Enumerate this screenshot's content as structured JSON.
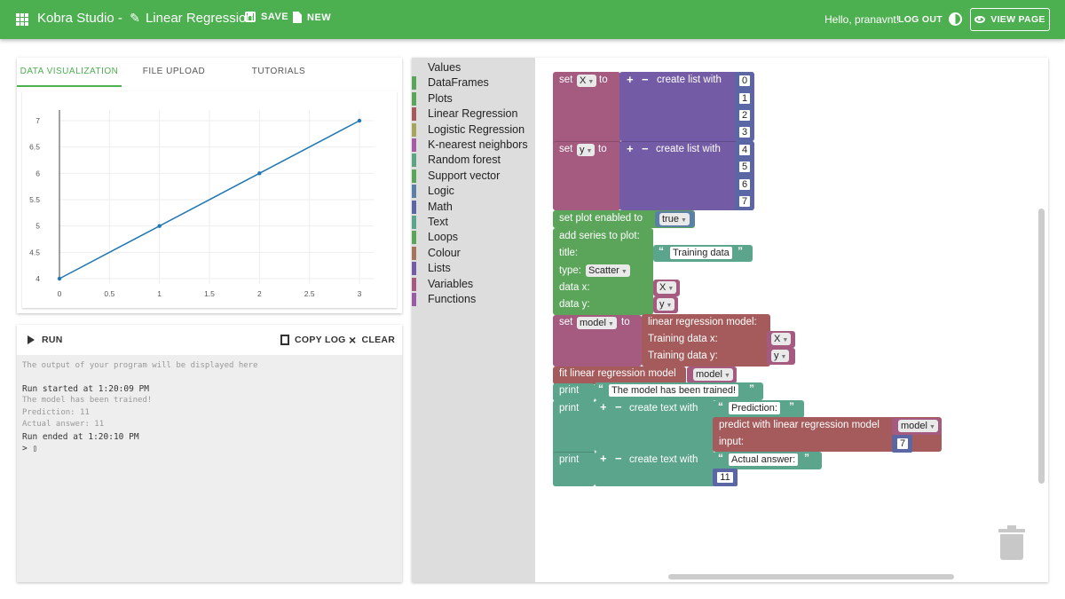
{
  "appbar": {
    "title": "Kobra Studio -",
    "project_name": "Linear Regression",
    "save_label": "SAVE",
    "new_label": "NEW",
    "greeting": "Hello, pranavnt!",
    "logout_label": "LOG OUT",
    "view_page_label": "VIEW PAGE",
    "bg_color": "#4caf50"
  },
  "viz": {
    "tabs": [
      "DATA VISUALIZATION",
      "FILE UPLOAD",
      "TUTORIALS"
    ],
    "active_tab": "DATA VISUALIZATION"
  },
  "chart_data": {
    "type": "line",
    "x": [
      0,
      1,
      2,
      3
    ],
    "y": [
      4,
      5,
      6,
      7
    ],
    "xlim": [
      0,
      3
    ],
    "ylim": [
      4,
      7
    ],
    "x_ticks": [
      "0",
      "0.5",
      "1",
      "1.5",
      "2",
      "2.5",
      "3"
    ],
    "y_ticks": [
      "4",
      "4.5",
      "5",
      "5.5",
      "6",
      "6.5",
      "7"
    ],
    "grid": true,
    "color": "#1f77b4",
    "markers": true
  },
  "console": {
    "run_label": "RUN",
    "copy_label": "COPY LOG",
    "clear_label": "CLEAR",
    "placeholder": "The output of your program will be displayed here",
    "run_started": "Run started at 1:20:09 PM",
    "line_trained": "The model has been trained!",
    "line_prediction": "Prediction: 11",
    "line_actual": "Actual answer: 11",
    "run_ended": "Run ended at 1:20:10 PM",
    "prompt": "> ▯"
  },
  "toolbox": {
    "categories": [
      {
        "label": "Values",
        "color": ""
      },
      {
        "label": "DataFrames",
        "color": "#5ba55b"
      },
      {
        "label": "Plots",
        "color": "#5ba55b"
      },
      {
        "label": "Linear Regression",
        "color": "#a55b5b"
      },
      {
        "label": "Logistic Regression",
        "color": "#a5a55b"
      },
      {
        "label": "K-nearest neighbors",
        "color": "#a55ba5"
      },
      {
        "label": "Random forest",
        "color": "#5ba580"
      },
      {
        "label": "Support vector",
        "color": "#5ba55b"
      },
      {
        "label": "Logic",
        "color": "#5b80a5"
      },
      {
        "label": "Math",
        "color": "#5b67a5"
      },
      {
        "label": "Text",
        "color": "#5ba58c"
      },
      {
        "label": "Loops",
        "color": "#5ba55b"
      },
      {
        "label": "Colour",
        "color": "#a5745b"
      },
      {
        "label": "Lists",
        "color": "#745ba5"
      },
      {
        "label": "Variables",
        "color": "#a55b80"
      },
      {
        "label": "Functions",
        "color": "#995ba5"
      }
    ]
  },
  "blocks": {
    "set_label": "set",
    "to_label": "to",
    "plus": "+",
    "minus": "−",
    "create_list_with": "create list with",
    "var_x": "X",
    "var_y": "y",
    "x_values": [
      "0",
      "1",
      "2",
      "3"
    ],
    "y_values": [
      "4",
      "5",
      "6",
      "7"
    ],
    "set_plot_enabled": "set plot enabled to",
    "bool_true": "true",
    "add_series": "add series to plot:",
    "title_label": "title:",
    "training_data": "Training data",
    "type_label": "type:",
    "type_value": "Scatter",
    "data_x_label": "data x:",
    "data_y_label": "data y:",
    "var_model": "model",
    "lr_model": "linear regression model:",
    "training_x_label": "Training data x:",
    "training_y_label": "Training data y:",
    "fit_label": "fit linear regression model",
    "print_label": "print",
    "trained_msg": "The model has been trained!",
    "create_text_with": "create text with",
    "prediction_str": "Prediction:",
    "predict_label": "predict with linear regression model",
    "input_label": "input:",
    "input_value": "7",
    "actual_str": "Actual answer:",
    "actual_value": "11",
    "quote_open": "“",
    "quote_close": "”",
    "colors": {
      "variables": "#a55b80",
      "lists": "#745ba5",
      "math": "#5b67a5",
      "plots": "#5ba55b",
      "linreg": "#a55b5b",
      "text": "#5ba58c",
      "logic": "#5b80a5"
    }
  }
}
